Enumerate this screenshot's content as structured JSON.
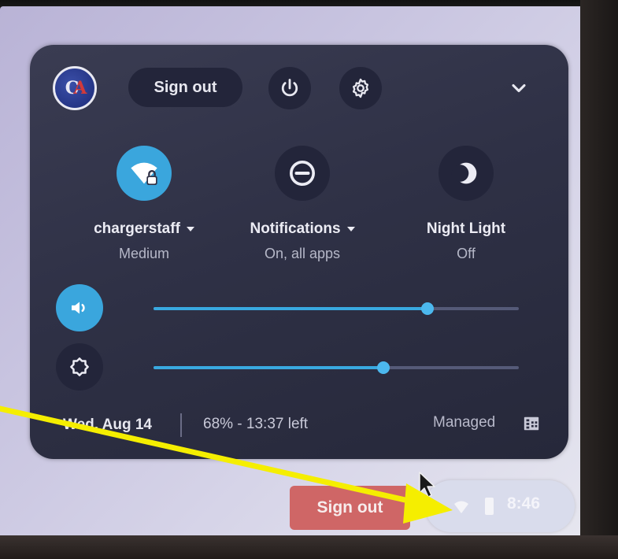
{
  "quick_settings": {
    "signout_label": "Sign out",
    "icons": {
      "avatar": "profile-avatar",
      "power": "power-icon",
      "settings": "gear-icon",
      "collapse": "chevron-down-icon"
    },
    "avatar_text": {
      "c": "C",
      "a": "A"
    },
    "features": [
      {
        "label": "chargerstaff",
        "sub": "Medium",
        "icon": "wifi-lock-icon",
        "has_dropdown": true,
        "active": true
      },
      {
        "label": "Notifications",
        "sub": "On, all apps",
        "icon": "do-not-disturb-icon",
        "has_dropdown": true,
        "active": false
      },
      {
        "label": "Night Light",
        "sub": "Off",
        "icon": "night-light-icon",
        "has_dropdown": false,
        "active": false
      }
    ],
    "sliders": {
      "volume": {
        "icon": "volume-icon",
        "level": 0.75
      },
      "brightness": {
        "icon": "brightness-icon",
        "level": 0.63
      }
    },
    "status": {
      "date": "Wed, Aug 14",
      "battery": "68% - 13:37 left",
      "managed": "Managed",
      "managed_icon": "building-icon"
    }
  },
  "shelf": {
    "signout_label": "Sign out",
    "time": "8:46",
    "icons": {
      "wifi": "wifi-icon",
      "battery": "battery-icon"
    }
  },
  "colors": {
    "accent": "#39a9e0",
    "bubble_bg": "#2f3146",
    "shelf_signout": "#cf6666",
    "annotation_arrow": "#f5ee00"
  }
}
